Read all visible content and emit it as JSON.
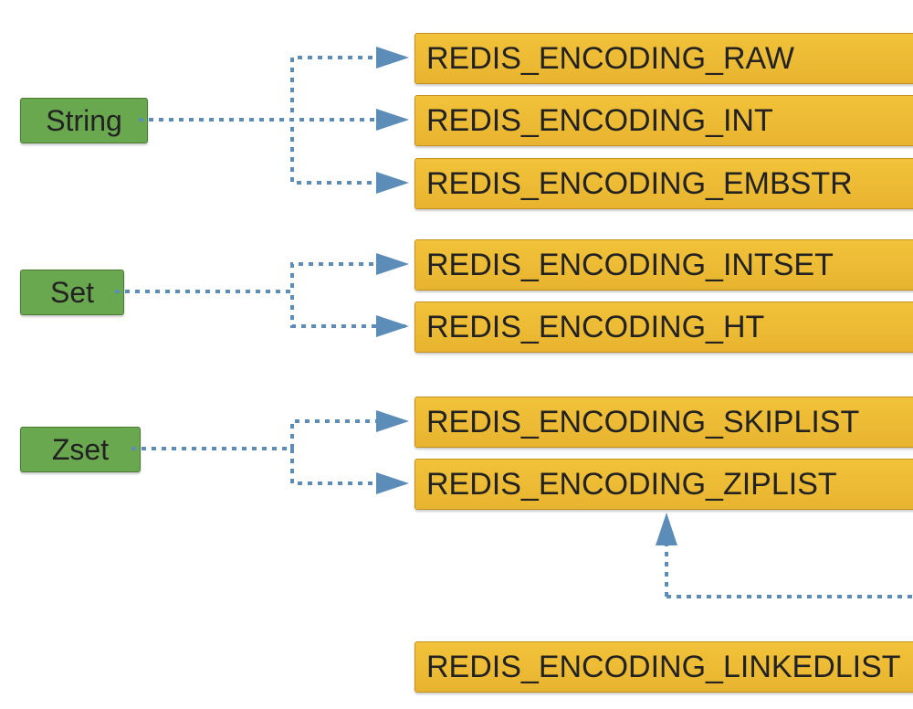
{
  "types": {
    "string": {
      "label": "String"
    },
    "set": {
      "label": "Set"
    },
    "zset": {
      "label": "Zset"
    }
  },
  "encodings": {
    "raw": "REDIS_ENCODING_RAW",
    "int": "REDIS_ENCODING_INT",
    "embstr": "REDIS_ENCODING_EMBSTR",
    "intset": "REDIS_ENCODING_INTSET",
    "ht": "REDIS_ENCODING_HT",
    "skiplist": "REDIS_ENCODING_SKIPLIST",
    "ziplist": "REDIS_ENCODING_ZIPLIST",
    "linkedlist": "REDIS_ENCODING_LINKEDLIST"
  },
  "colors": {
    "connector": "#5b8db8"
  }
}
